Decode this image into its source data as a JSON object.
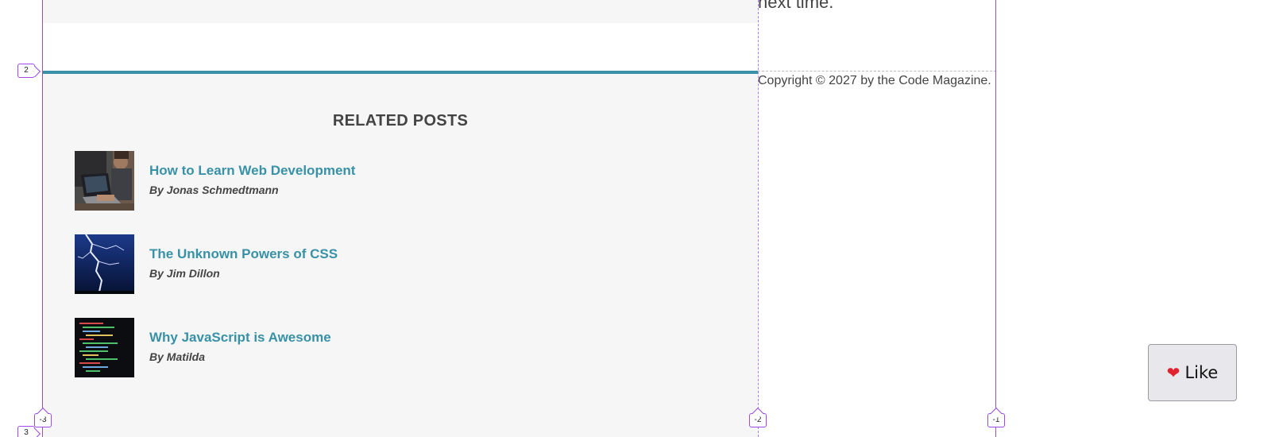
{
  "article": {
    "aside_partial_text": "next time."
  },
  "related": {
    "title": "RELATED POSTS",
    "posts": [
      {
        "title": "How to Learn Web Development",
        "author": "By Jonas Schmedtmann",
        "thumb": "laptop-photo"
      },
      {
        "title": "The Unknown Powers of CSS",
        "author": "By Jim Dillon",
        "thumb": "lightning-photo"
      },
      {
        "title": "Why JavaScript is Awesome",
        "author": "By Matilda",
        "thumb": "code-photo"
      }
    ]
  },
  "footer": {
    "copyright": "Copyright © 2027 by the Code Magazine."
  },
  "grid_overlay": {
    "row_labels": [
      "2",
      "3"
    ],
    "column_labels": [
      "-3",
      "-2",
      "-1"
    ]
  },
  "like_button": {
    "label": "Like",
    "icon": "heart-icon"
  },
  "colors": {
    "accent": "#3891a6",
    "overlay": "#9b4be6",
    "section_bg": "#f6f6f6",
    "text": "#444444"
  }
}
